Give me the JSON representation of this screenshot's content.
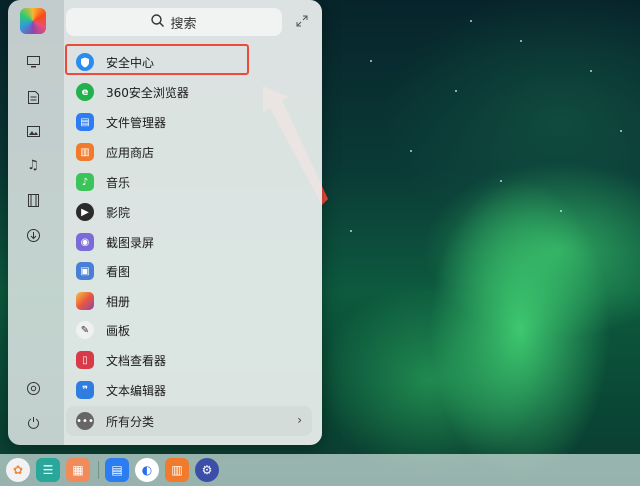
{
  "search": {
    "placeholder": "搜索"
  },
  "sidebar": {
    "icons": [
      "computer-icon",
      "document-icon",
      "image-icon",
      "music-icon",
      "video-icon",
      "download-icon",
      "settings-icon",
      "power-icon"
    ]
  },
  "apps": [
    {
      "label": "安全中心",
      "icon": "shield-icon",
      "color": "#2b8cf0"
    },
    {
      "label": "360安全浏览器",
      "icon": "browser-icon",
      "color": "#22b14c"
    },
    {
      "label": "文件管理器",
      "icon": "folder-icon",
      "color": "#2d7df2"
    },
    {
      "label": "应用商店",
      "icon": "store-icon",
      "color": "#f07b2c"
    },
    {
      "label": "音乐",
      "icon": "music-icon",
      "color": "#3bc45a"
    },
    {
      "label": "影院",
      "icon": "video-icon",
      "color": "#2b2b2b"
    },
    {
      "label": "截图录屏",
      "icon": "camera-icon",
      "color": "#7b6bd8"
    },
    {
      "label": "看图",
      "icon": "photo-viewer-icon",
      "color": "#4a7fd8"
    },
    {
      "label": "相册",
      "icon": "album-icon",
      "color": "#e9573f"
    },
    {
      "label": "画板",
      "icon": "paint-icon",
      "color": "#f0f0f0"
    },
    {
      "label": "文档查看器",
      "icon": "document-viewer-icon",
      "color": "#d93a4a"
    },
    {
      "label": "文本编辑器",
      "icon": "text-editor-icon",
      "color": "#2f7de1"
    }
  ],
  "all_categories": {
    "label": "所有分类"
  },
  "taskbar": [
    "launcher-icon",
    "multitask-icon",
    "app-grid-icon",
    "file-manager-icon",
    "browser-icon",
    "app-store-icon",
    "settings-icon"
  ],
  "colors": {
    "highlight": "#ee4a3c",
    "arrow": "#ee4a3c"
  }
}
